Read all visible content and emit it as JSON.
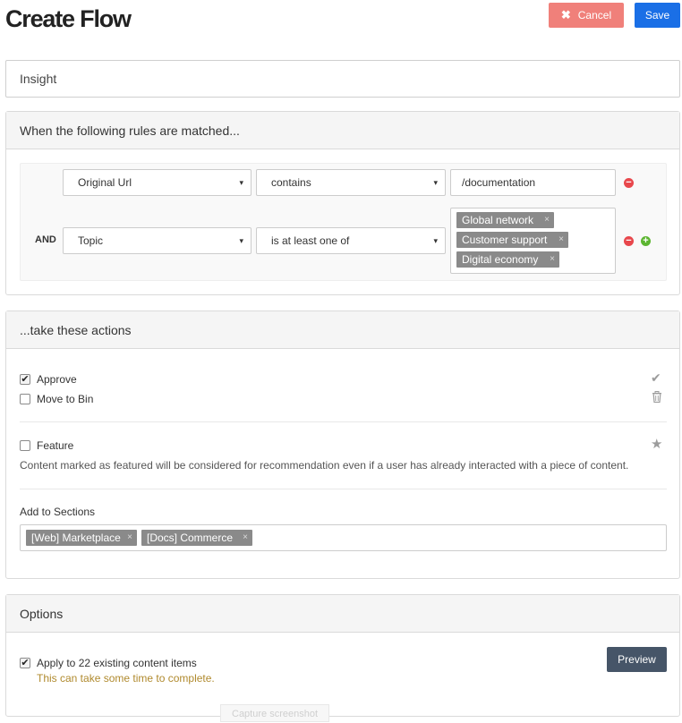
{
  "header": {
    "title": "Create Flow",
    "cancel_icon": "✖",
    "cancel_label": "Cancel",
    "save_label": "Save"
  },
  "flow_name": {
    "value": "Insight"
  },
  "rules": {
    "heading": "When the following rules are matched...",
    "rows": [
      {
        "connector": "",
        "field": "Original Url",
        "operator": "contains",
        "value": "/documentation"
      },
      {
        "connector": "AND",
        "field": "Topic",
        "operator": "is at least one of",
        "tags": [
          "Global network",
          "Customer support",
          "Digital economy"
        ]
      }
    ],
    "caret": "▾",
    "tag_remove": "×",
    "remove_icon": "−",
    "add_icon": "+"
  },
  "actions": {
    "heading": "...take these actions",
    "approve": {
      "label": "Approve",
      "checked": true,
      "icon": "check-icon"
    },
    "move_to_bin": {
      "label": "Move to Bin",
      "checked": false,
      "icon": "trash-icon"
    },
    "feature": {
      "label": "Feature",
      "checked": false,
      "icon": "star-icon",
      "description": "Content marked as featured will be considered for recommendation even if a user has already interacted with a piece of content."
    },
    "sections": {
      "label": "Add to Sections",
      "tags": [
        "[Web] Marketplace",
        "[Docs] Commerce"
      ]
    }
  },
  "options": {
    "heading": "Options",
    "apply": {
      "label": "Apply to 22 existing content items",
      "checked": true
    },
    "note": "This can take some time to complete.",
    "preview_label": "Preview"
  },
  "overlay": {
    "capture_label": "Capture screenshot"
  },
  "colors": {
    "cancel": "#f0807a",
    "save": "#1a6fe6",
    "preview": "#465568",
    "remove": "#e8474c",
    "add": "#5cb531",
    "tag": "#8a8a8a",
    "note": "#b08a2e"
  }
}
